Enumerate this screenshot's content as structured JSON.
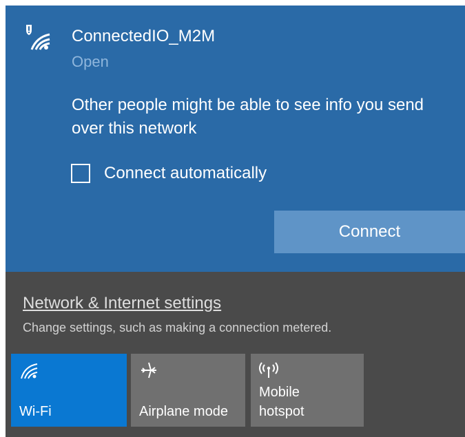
{
  "network": {
    "name": "ConnectedIO_M2M",
    "status": "Open",
    "warning": "Other people might be able to see info you send over this network",
    "connect_automatically_label": "Connect automatically",
    "connect_automatically_checked": false,
    "connect_button_label": "Connect",
    "icon": "open-wifi-shield-icon"
  },
  "settings": {
    "link_label": "Network & Internet settings",
    "description": "Change settings, such as making a connection metered."
  },
  "quick_actions": [
    {
      "label": "Wi-Fi",
      "icon": "wifi-icon",
      "active": true
    },
    {
      "label": "Airplane mode",
      "icon": "airplane-icon",
      "active": false
    },
    {
      "label_line1": "Mobile",
      "label_line2": "hotspot",
      "icon": "hotspot-icon",
      "active": false
    }
  ],
  "colors": {
    "network_card": "#2a6aa7",
    "connect_button": "#5f94c7",
    "active_tile": "#0a78d2",
    "inactive_tile": "#707070",
    "panel": "#4a4a4a"
  }
}
